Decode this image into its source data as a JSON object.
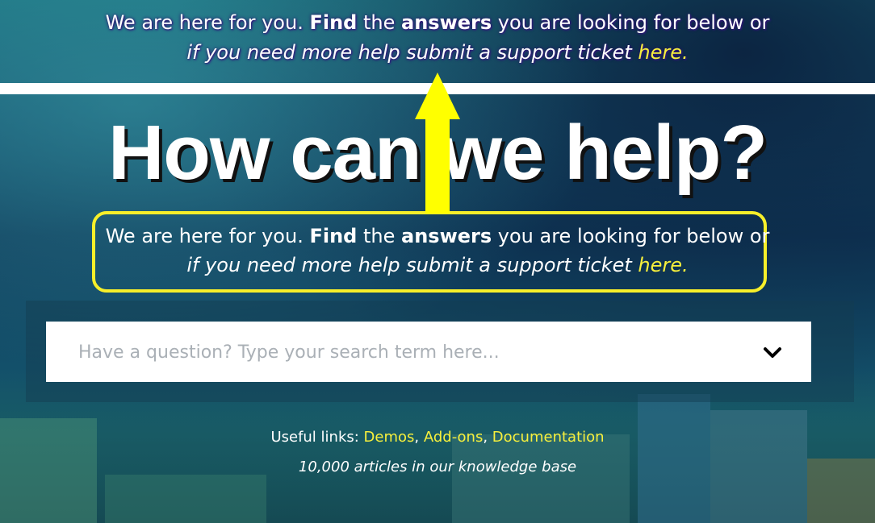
{
  "top_strip": {
    "p1": "We are here for you. ",
    "find": "Find",
    "p2": " the ",
    "answers": "answers",
    "p3": " you are looking for below or",
    "line2": "if you need more help submit a support ticket ",
    "here": "here",
    "dot": "."
  },
  "headline": {
    "regular": "How can we ",
    "bold": "help?"
  },
  "subtitle": {
    "p1": "We are here for you. ",
    "find": "Find",
    "p2": " the ",
    "answers": "answers",
    "p3": " you are looking for below or",
    "line2": "if you need more help submit a support ticket ",
    "here": "here."
  },
  "search": {
    "placeholder": "Have a question? Type your search term here..."
  },
  "useful_links": {
    "label": "Useful links: ",
    "items": [
      "Demos",
      "Add-ons",
      "Documentation"
    ],
    "sep": ", "
  },
  "article_count": "10,000 articles in our knowledge base",
  "colors": {
    "accent_yellow": "#f7f03c",
    "callout_border": "#f7ef2a",
    "arrow": "#ffff00"
  }
}
